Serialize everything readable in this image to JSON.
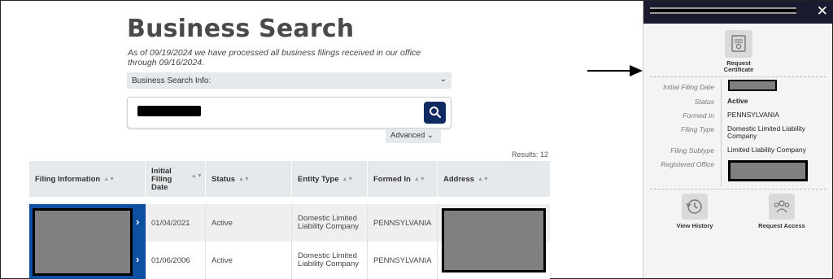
{
  "page": {
    "title": "Business Search",
    "subtitle": "As of 09/19/2024 we have processed all business filings received in our office through 09/16/2024.",
    "search_info_label": "Business Search Info:",
    "advanced_label": "Advanced",
    "results_label": "Results: 12"
  },
  "table": {
    "columns": [
      "Filing Information",
      "Initial Filing Date",
      "Status",
      "Entity Type",
      "Formed In",
      "Address"
    ],
    "rows": [
      {
        "date": "01/04/2021",
        "status": "Active",
        "entity_type": "Domestic Limited Liability Company",
        "formed_in": "PENNSYLVANIA"
      },
      {
        "date": "01/06/2006",
        "status": "Active",
        "entity_type": "Domestic Limited Liability Company",
        "formed_in": "PENNSYLVANIA"
      }
    ]
  },
  "panel": {
    "request_certificate": "Request Certificate",
    "fields": [
      {
        "label": "Initial Filing Date",
        "value": ""
      },
      {
        "label": "Status",
        "value": "Active"
      },
      {
        "label": "Formed In",
        "value": "PENNSYLVANIA"
      },
      {
        "label": "Filing Type",
        "value": "Domestic Limited Liability Company"
      },
      {
        "label": "Filing Subtype",
        "value": "Limited Liability Company"
      },
      {
        "label": "Registered Office",
        "value": ""
      }
    ],
    "view_history": "View History",
    "request_access": "Request Access"
  },
  "colors": {
    "accent": "#0d2b61",
    "row_highlight": "#0d4fa0",
    "panel_header": "#1b1b2f"
  }
}
